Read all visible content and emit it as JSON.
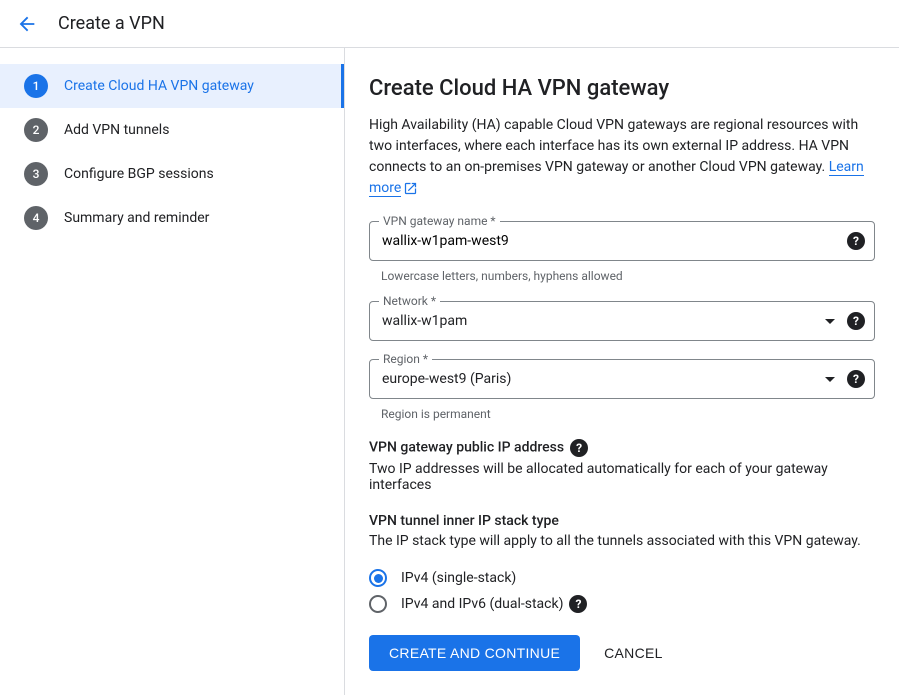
{
  "header": {
    "title": "Create a VPN"
  },
  "sidebar": {
    "steps": [
      {
        "num": "1",
        "label": "Create Cloud HA VPN gateway"
      },
      {
        "num": "2",
        "label": "Add VPN tunnels"
      },
      {
        "num": "3",
        "label": "Configure BGP sessions"
      },
      {
        "num": "4",
        "label": "Summary and reminder"
      }
    ]
  },
  "main": {
    "title": "Create Cloud HA VPN gateway",
    "description": "High Availability (HA) capable Cloud VPN gateways are regional resources with two interfaces, where each interface has its own external IP address. HA VPN connects to an on-premises VPN gateway or another Cloud VPN gateway. ",
    "learn_more": "Learn more",
    "fields": {
      "gateway_name": {
        "label": "VPN gateway name *",
        "value": "wallix-w1pam-west9",
        "hint": "Lowercase letters, numbers, hyphens allowed"
      },
      "network": {
        "label": "Network *",
        "value": "wallix-w1pam"
      },
      "region": {
        "label": "Region *",
        "value": "europe-west9 (Paris)",
        "hint": "Region is permanent"
      }
    },
    "ip_section": {
      "label": "VPN gateway public IP address",
      "text": "Two IP addresses will be allocated automatically for each of your gateway interfaces"
    },
    "stack_section": {
      "label": "VPN tunnel inner IP stack type",
      "text": "The IP stack type will apply to all the tunnels associated with this VPN gateway.",
      "options": [
        {
          "label": "IPv4 (single-stack)",
          "selected": true
        },
        {
          "label": "IPv4 and IPv6 (dual-stack)",
          "selected": false,
          "help": true
        }
      ]
    },
    "buttons": {
      "primary": "CREATE AND CONTINUE",
      "cancel": "CANCEL"
    }
  }
}
